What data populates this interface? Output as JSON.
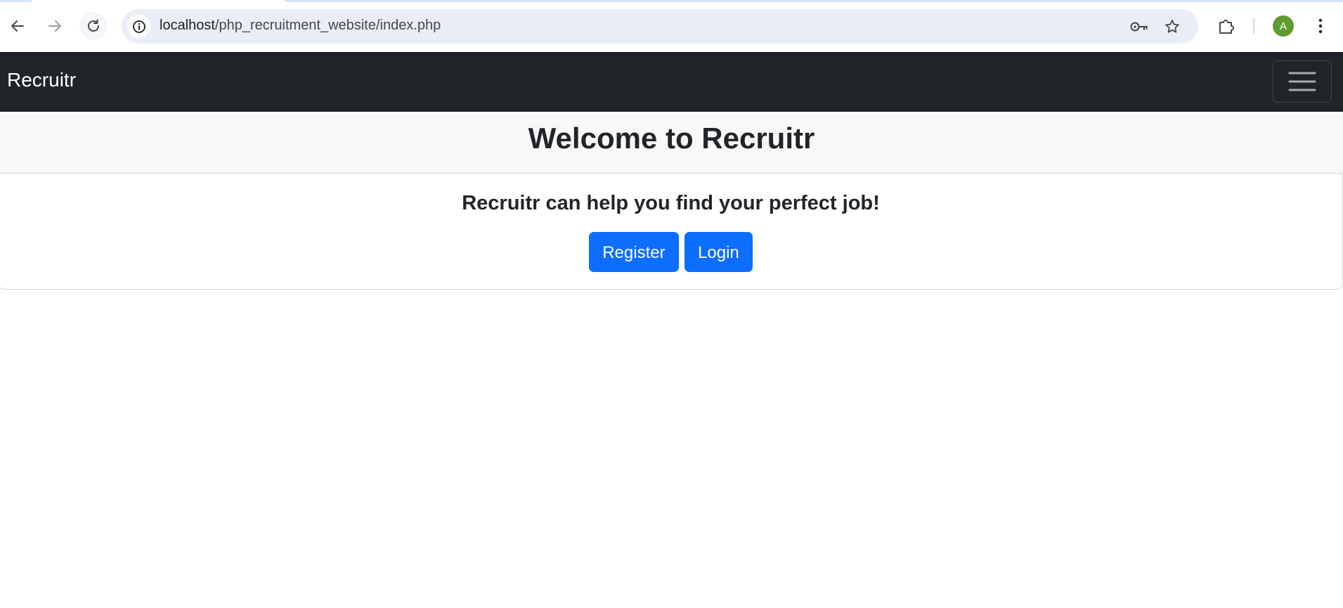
{
  "browser": {
    "url_host": "localhost",
    "url_path": "/php_recruitment_website/index.php",
    "profile_initial": "A",
    "icons": {
      "back": "back-arrow-icon",
      "forward": "forward-arrow-icon",
      "reload": "reload-icon",
      "site_info": "info-icon",
      "password": "key-icon",
      "bookmark": "star-icon",
      "extensions": "puzzle-icon",
      "menu": "kebab-menu-icon"
    }
  },
  "navbar": {
    "brand": "Recruitr",
    "toggler_icon": "hamburger-icon",
    "background": "#212529"
  },
  "header": {
    "title": "Welcome to Recruitr"
  },
  "main": {
    "tagline": "Recruitr can help you find your perfect job!",
    "register_label": "Register",
    "login_label": "Login"
  },
  "colors": {
    "primary": "#0d6efd",
    "avatar": "#5f9c32"
  }
}
